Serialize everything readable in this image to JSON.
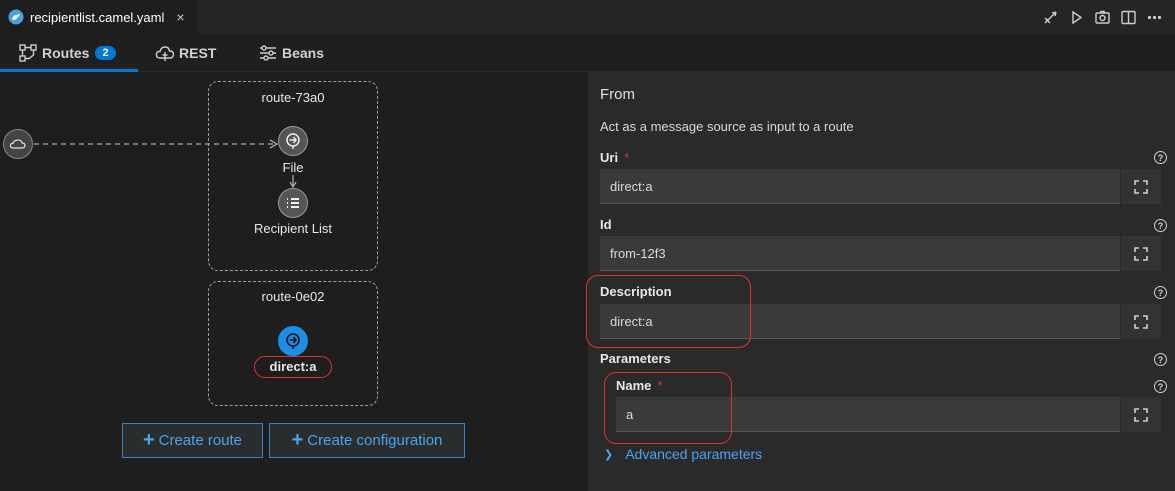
{
  "editor": {
    "tab_title": "recipientlist.camel.yaml",
    "tab_close": "×",
    "actions": [
      "deploy-icon",
      "run-icon",
      "screenshot-icon",
      "split-editor-icon",
      "more-icon"
    ]
  },
  "nav": {
    "routes_label": "Routes",
    "routes_count": "2",
    "rest_label": "REST",
    "beans_label": "Beans"
  },
  "canvas": {
    "routes": [
      {
        "title": "route-73a0",
        "nodes": [
          {
            "label": "File",
            "icon": "file-endpoint-icon"
          },
          {
            "label": "Recipient List",
            "icon": "list-icon"
          }
        ]
      },
      {
        "title": "route-0e02",
        "nodes": [
          {
            "label": "direct:a",
            "icon": "direct-endpoint-icon"
          }
        ]
      }
    ],
    "create_route_label": "Create route",
    "create_configuration_label": "Create configuration"
  },
  "panel": {
    "title": "From",
    "description": "Act as a message source as input to a route",
    "fields": {
      "uri": {
        "label": "Uri",
        "value": "direct:a",
        "required": "*"
      },
      "id": {
        "label": "Id",
        "value": "from-12f3"
      },
      "description": {
        "label": "Description",
        "value": "direct:a"
      },
      "parameters_label": "Parameters",
      "name": {
        "label": "Name",
        "value": "a",
        "required": "*"
      }
    },
    "advanced_label": "Advanced parameters",
    "help_glyph": "?"
  },
  "colors": {
    "accent": "#0078d4",
    "link": "#4aa3f0",
    "highlight": "#e0322f"
  }
}
